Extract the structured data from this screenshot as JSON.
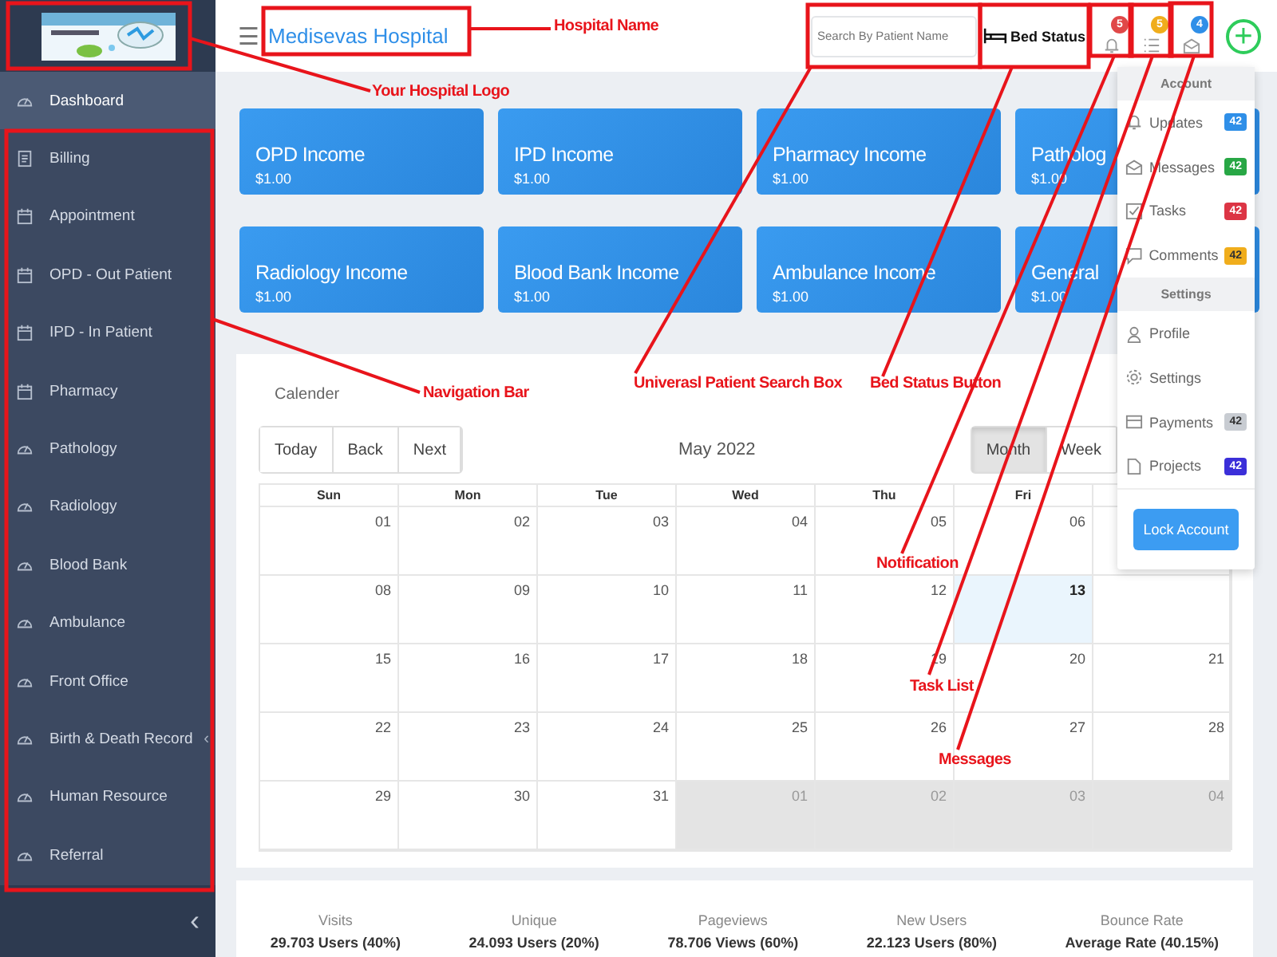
{
  "sidebar": {
    "items": [
      {
        "label": "Dashboard",
        "kind": "gauge",
        "selected": true
      },
      {
        "label": "Billing",
        "kind": "document",
        "selected": false
      },
      {
        "label": "Appointment",
        "kind": "calendar",
        "selected": false
      },
      {
        "label": "OPD - Out Patient",
        "kind": "calendar",
        "selected": false
      },
      {
        "label": "IPD - In Patient",
        "kind": "calendar",
        "selected": false
      },
      {
        "label": "Pharmacy",
        "kind": "calendar",
        "selected": false
      },
      {
        "label": "Pathology",
        "kind": "gauge",
        "selected": false
      },
      {
        "label": "Radiology",
        "kind": "gauge",
        "selected": false
      },
      {
        "label": "Blood Bank",
        "kind": "gauge",
        "selected": false
      },
      {
        "label": "Ambulance",
        "kind": "gauge",
        "selected": false
      },
      {
        "label": "Front Office",
        "kind": "gauge",
        "selected": false
      },
      {
        "label": "Birth & Death Record",
        "kind": "gauge",
        "selected": false,
        "caret": "‹"
      },
      {
        "label": "Human Resource",
        "kind": "gauge",
        "selected": false
      },
      {
        "label": "Referral",
        "kind": "gauge",
        "selected": false
      }
    ],
    "collapse": "‹"
  },
  "header": {
    "menu": "☰",
    "title": "Medisevas Hospital",
    "search": {
      "placeholder": "Search By Patient Name"
    },
    "bed_button": "Bed Status",
    "icons": [
      {
        "kind": "bell",
        "badge": "5",
        "color": "#e04848"
      },
      {
        "kind": "tasks",
        "badge": "5",
        "color": "#f0ad1c"
      },
      {
        "kind": "mail",
        "badge": "4",
        "color": "#2f8fe8"
      }
    ],
    "add": "+"
  },
  "income_cards": [
    {
      "title": "OPD Income",
      "amount": "$1.00"
    },
    {
      "title": "IPD Income",
      "amount": "$1.00"
    },
    {
      "title": "Pharmacy Income",
      "amount": "$1.00"
    },
    {
      "title": "Patholog",
      "amount": "$1.00"
    },
    {
      "title": "Radiology Income",
      "amount": "$1.00"
    },
    {
      "title": "Blood Bank Income",
      "amount": "$1.00"
    },
    {
      "title": "Ambulance Income",
      "amount": "$1.00"
    },
    {
      "title": "General",
      "amount": "$1.00"
    }
  ],
  "calendar": {
    "title": "Calender",
    "nav": [
      {
        "label": "Today"
      },
      {
        "label": "Back"
      },
      {
        "label": "Next"
      }
    ],
    "month": "May 2022",
    "views": [
      {
        "label": "Month",
        "selected": true
      },
      {
        "label": "Week",
        "selected": false
      }
    ],
    "weekdays": [
      "Sun",
      "Mon",
      "Tue",
      "Wed",
      "Thu",
      "Fri"
    ],
    "weeks": [
      [
        {
          "d": "01",
          "kind": "day"
        },
        {
          "d": "02",
          "kind": "day"
        },
        {
          "d": "03",
          "kind": "day"
        },
        {
          "d": "04",
          "kind": "day"
        },
        {
          "d": "05",
          "kind": "day"
        },
        {
          "d": "06",
          "kind": "day"
        }
      ],
      [
        {
          "d": "08",
          "kind": "day"
        },
        {
          "d": "09",
          "kind": "day"
        },
        {
          "d": "10",
          "kind": "day"
        },
        {
          "d": "11",
          "kind": "day"
        },
        {
          "d": "12",
          "kind": "day"
        },
        {
          "d": "13",
          "kind": "today"
        }
      ],
      [
        {
          "d": "15",
          "kind": "day"
        },
        {
          "d": "16",
          "kind": "day"
        },
        {
          "d": "17",
          "kind": "day"
        },
        {
          "d": "18",
          "kind": "day"
        },
        {
          "d": "19",
          "kind": "day"
        },
        {
          "d": "20",
          "kind": "day"
        },
        {
          "d": "21",
          "kind": "day"
        }
      ],
      [
        {
          "d": "22",
          "kind": "day"
        },
        {
          "d": "23",
          "kind": "day"
        },
        {
          "d": "24",
          "kind": "day"
        },
        {
          "d": "25",
          "kind": "day"
        },
        {
          "d": "26",
          "kind": "day"
        },
        {
          "d": "27",
          "kind": "day"
        },
        {
          "d": "28",
          "kind": "day"
        }
      ],
      [
        {
          "d": "29",
          "kind": "day"
        },
        {
          "d": "30",
          "kind": "day"
        },
        {
          "d": "31",
          "kind": "day"
        },
        {
          "d": "01",
          "kind": "other"
        },
        {
          "d": "02",
          "kind": "other"
        },
        {
          "d": "03",
          "kind": "other"
        },
        {
          "d": "04",
          "kind": "other"
        }
      ]
    ]
  },
  "stats": [
    {
      "label": "Visits",
      "value": "29.703 Users (40%)"
    },
    {
      "label": "Unique",
      "value": "24.093 Users (20%)"
    },
    {
      "label": "Pageviews",
      "value": "78.706 Views (60%)"
    },
    {
      "label": "New Users",
      "value": "22.123 Users (80%)"
    },
    {
      "label": "Bounce Rate",
      "value": "Average Rate (40.15%)"
    }
  ],
  "dropdown": {
    "sections": [
      {
        "title": "Account",
        "items": [
          {
            "label": "Updates",
            "kind": "bell",
            "badge": "42",
            "color": "#2f8fe8"
          },
          {
            "label": "Messages",
            "kind": "mail",
            "badge": "42",
            "color": "#28a745"
          },
          {
            "label": "Tasks",
            "kind": "check",
            "badge": "42",
            "color": "#dc3545"
          },
          {
            "label": "Comments",
            "kind": "comment",
            "badge": "42",
            "color": "#f0ad1c"
          }
        ]
      },
      {
        "title": "Settings",
        "items": [
          {
            "label": "Profile",
            "kind": "user"
          },
          {
            "label": "Settings",
            "kind": "gear"
          },
          {
            "label": "Payments",
            "kind": "card",
            "badge": "42",
            "color": "#c8ccd2"
          },
          {
            "label": "Projects",
            "kind": "file",
            "badge": "42",
            "color": "#3b2fd9"
          }
        ]
      }
    ],
    "button": "Lock Account"
  },
  "annotations": [
    {
      "label": "Hospital Name"
    },
    {
      "label": "Your Hospital Logo"
    },
    {
      "label": "Navigation Bar"
    },
    {
      "label": "Univerasl Patient Search Box"
    },
    {
      "label": "Bed Status Button"
    },
    {
      "label": "Notification"
    },
    {
      "label": "Task List"
    },
    {
      "label": "Messages"
    }
  ]
}
